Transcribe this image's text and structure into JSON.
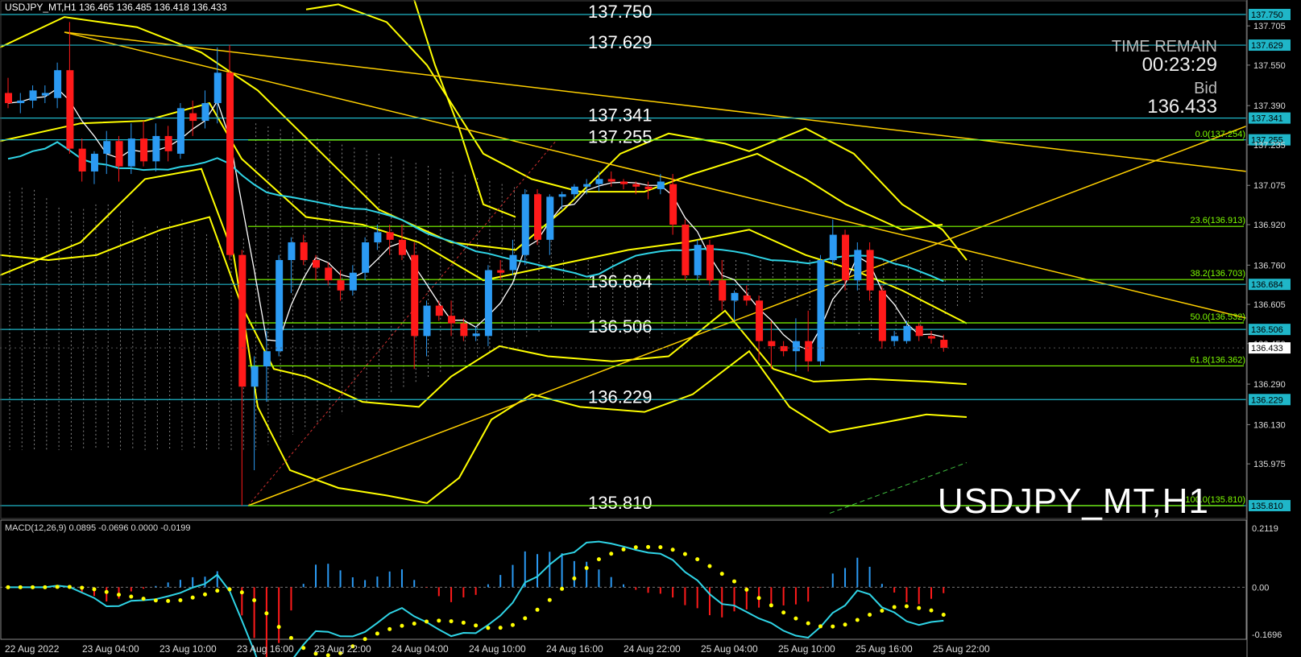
{
  "header": {
    "symbol_line": "USDJPY_MT,H1  136.465 136.485 136.418 136.433"
  },
  "info": {
    "time_remain_label": "TIME REMAIN",
    "time_remain_value": "00:23:29",
    "bid_label": "Bid",
    "bid_value": "136.433"
  },
  "watermark": "USDJPY_MT,H1",
  "macd_label": "MACD(12,26,9) 0.0895 -0.0696 0.0000 -0.0199",
  "colors": {
    "background": "#000000",
    "up_candle": "#2b9af3",
    "down_candle": "#ff1a1a",
    "bollinger": "#ffff00",
    "trendline": "#ffd000",
    "ma_cyan": "#2fd4e6",
    "ma_white": "#ffffff",
    "hline_cyan": "#1fb6c8",
    "fib_green": "#7fff00",
    "macd_line": "#2fd4e6",
    "macd_signal": "#ffff00"
  },
  "price_axis": {
    "ticks": [
      "137.705",
      "137.550",
      "137.390",
      "137.235",
      "137.075",
      "136.920",
      "136.760",
      "136.605",
      "136.450",
      "136.290",
      "136.130",
      "135.975"
    ],
    "ticks_values": [
      137.705,
      137.55,
      137.39,
      137.235,
      137.075,
      136.92,
      136.76,
      136.605,
      136.45,
      136.29,
      136.13,
      135.975
    ],
    "current_price": "136.433",
    "range": [
      135.79,
      137.77
    ]
  },
  "level_lines": [
    {
      "label": "137.750",
      "value": 137.75
    },
    {
      "label": "137.629",
      "value": 137.629
    },
    {
      "label": "137.341",
      "value": 137.341
    },
    {
      "label": "137.255",
      "value": 137.255
    },
    {
      "label": "136.684",
      "value": 136.684
    },
    {
      "label": "136.506",
      "value": 136.506
    },
    {
      "label": "136.229",
      "value": 136.229
    },
    {
      "label": "135.810",
      "value": 135.81
    }
  ],
  "fib_levels": [
    {
      "label": "0.0(137.254)",
      "value": 137.254
    },
    {
      "label": "23.6(136.913)",
      "value": 136.913
    },
    {
      "label": "38.2(136.703)",
      "value": 136.703
    },
    {
      "label": "50.0(136.532)",
      "value": 136.532
    },
    {
      "label": "61.8(136.362)",
      "value": 136.362
    },
    {
      "label": "100.0(135.810)",
      "value": 135.81
    }
  ],
  "time_axis": [
    "22 Aug 2022",
    "23 Aug 04:00",
    "23 Aug 10:00",
    "23 Aug 16:00",
    "23 Aug 22:00",
    "24 Aug 04:00",
    "24 Aug 10:00",
    "24 Aug 16:00",
    "24 Aug 22:00",
    "25 Aug 04:00",
    "25 Aug 10:00",
    "25 Aug 16:00",
    "25 Aug 22:00"
  ],
  "macd_axis": [
    "0.2119",
    "0.00",
    "-0.1696"
  ],
  "macd_axis_values": [
    0.2119,
    0.0,
    -0.1696
  ],
  "chart_data": {
    "type": "candlestick",
    "candles": [
      {
        "o": 137.44,
        "h": 137.5,
        "l": 137.38,
        "c": 137.4
      },
      {
        "o": 137.4,
        "h": 137.44,
        "l": 137.36,
        "c": 137.41
      },
      {
        "o": 137.41,
        "h": 137.47,
        "l": 137.38,
        "c": 137.45
      },
      {
        "o": 137.43,
        "h": 137.47,
        "l": 137.4,
        "c": 137.44
      },
      {
        "o": 137.42,
        "h": 137.56,
        "l": 137.38,
        "c": 137.53
      },
      {
        "o": 137.53,
        "h": 137.72,
        "l": 137.2,
        "c": 137.22
      },
      {
        "o": 137.22,
        "h": 137.26,
        "l": 137.09,
        "c": 137.13
      },
      {
        "o": 137.13,
        "h": 137.21,
        "l": 137.08,
        "c": 137.2
      },
      {
        "o": 137.2,
        "h": 137.29,
        "l": 137.12,
        "c": 137.25
      },
      {
        "o": 137.25,
        "h": 137.27,
        "l": 137.09,
        "c": 137.15
      },
      {
        "o": 137.15,
        "h": 137.32,
        "l": 137.12,
        "c": 137.26
      },
      {
        "o": 137.26,
        "h": 137.33,
        "l": 137.15,
        "c": 137.17
      },
      {
        "o": 137.17,
        "h": 137.32,
        "l": 137.13,
        "c": 137.27
      },
      {
        "o": 137.27,
        "h": 137.31,
        "l": 137.17,
        "c": 137.21
      },
      {
        "o": 137.2,
        "h": 137.4,
        "l": 137.18,
        "c": 137.38
      },
      {
        "o": 137.36,
        "h": 137.41,
        "l": 137.27,
        "c": 137.33
      },
      {
        "o": 137.33,
        "h": 137.45,
        "l": 137.3,
        "c": 137.4
      },
      {
        "o": 137.4,
        "h": 137.62,
        "l": 137.32,
        "c": 137.52
      },
      {
        "o": 137.52,
        "h": 137.63,
        "l": 136.78,
        "c": 136.8
      },
      {
        "o": 136.8,
        "h": 136.82,
        "l": 135.81,
        "c": 136.28
      },
      {
        "o": 136.28,
        "h": 136.4,
        "l": 135.95,
        "c": 136.36
      },
      {
        "o": 136.36,
        "h": 136.5,
        "l": 136.22,
        "c": 136.42
      },
      {
        "o": 136.42,
        "h": 136.8,
        "l": 136.4,
        "c": 136.78
      },
      {
        "o": 136.78,
        "h": 136.87,
        "l": 136.65,
        "c": 136.85
      },
      {
        "o": 136.85,
        "h": 136.88,
        "l": 136.76,
        "c": 136.78
      },
      {
        "o": 136.78,
        "h": 136.8,
        "l": 136.7,
        "c": 136.75
      },
      {
        "o": 136.75,
        "h": 136.77,
        "l": 136.68,
        "c": 136.7
      },
      {
        "o": 136.7,
        "h": 136.74,
        "l": 136.62,
        "c": 136.66
      },
      {
        "o": 136.66,
        "h": 136.76,
        "l": 136.64,
        "c": 136.73
      },
      {
        "o": 136.73,
        "h": 136.87,
        "l": 136.7,
        "c": 136.85
      },
      {
        "o": 136.85,
        "h": 136.92,
        "l": 136.82,
        "c": 136.89
      },
      {
        "o": 136.89,
        "h": 136.92,
        "l": 136.8,
        "c": 136.86
      },
      {
        "o": 136.86,
        "h": 136.92,
        "l": 136.78,
        "c": 136.8
      },
      {
        "o": 136.8,
        "h": 136.85,
        "l": 136.35,
        "c": 136.48
      },
      {
        "o": 136.48,
        "h": 136.62,
        "l": 136.4,
        "c": 136.6
      },
      {
        "o": 136.6,
        "h": 136.62,
        "l": 136.54,
        "c": 136.56
      },
      {
        "o": 136.56,
        "h": 136.62,
        "l": 136.48,
        "c": 136.53
      },
      {
        "o": 136.53,
        "h": 136.55,
        "l": 136.46,
        "c": 136.48
      },
      {
        "o": 136.48,
        "h": 136.52,
        "l": 136.46,
        "c": 136.49
      },
      {
        "o": 136.48,
        "h": 136.76,
        "l": 136.44,
        "c": 136.74
      },
      {
        "o": 136.74,
        "h": 136.78,
        "l": 136.7,
        "c": 136.73
      },
      {
        "o": 136.74,
        "h": 136.86,
        "l": 136.72,
        "c": 136.8
      },
      {
        "o": 136.8,
        "h": 137.06,
        "l": 136.76,
        "c": 137.04
      },
      {
        "o": 137.04,
        "h": 137.06,
        "l": 136.84,
        "c": 136.86
      },
      {
        "o": 136.86,
        "h": 137.04,
        "l": 136.8,
        "c": 137.03
      },
      {
        "o": 137.03,
        "h": 137.05,
        "l": 136.98,
        "c": 137.04
      },
      {
        "o": 137.04,
        "h": 137.08,
        "l": 137.02,
        "c": 137.07
      },
      {
        "o": 137.07,
        "h": 137.1,
        "l": 137.04,
        "c": 137.08
      },
      {
        "o": 137.08,
        "h": 137.13,
        "l": 137.05,
        "c": 137.1
      },
      {
        "o": 137.1,
        "h": 137.13,
        "l": 137.07,
        "c": 137.09
      },
      {
        "o": 137.09,
        "h": 137.1,
        "l": 137.06,
        "c": 137.08
      },
      {
        "o": 137.08,
        "h": 137.09,
        "l": 137.04,
        "c": 137.07
      },
      {
        "o": 137.07,
        "h": 137.09,
        "l": 137.02,
        "c": 137.06
      },
      {
        "o": 137.06,
        "h": 137.12,
        "l": 137.04,
        "c": 137.09
      },
      {
        "o": 137.08,
        "h": 137.12,
        "l": 136.88,
        "c": 136.92
      },
      {
        "o": 136.92,
        "h": 136.94,
        "l": 136.7,
        "c": 136.72
      },
      {
        "o": 136.72,
        "h": 136.86,
        "l": 136.7,
        "c": 136.84
      },
      {
        "o": 136.84,
        "h": 136.86,
        "l": 136.68,
        "c": 136.7
      },
      {
        "o": 136.7,
        "h": 136.78,
        "l": 136.58,
        "c": 136.62
      },
      {
        "o": 136.62,
        "h": 136.66,
        "l": 136.54,
        "c": 136.65
      },
      {
        "o": 136.64,
        "h": 136.68,
        "l": 136.6,
        "c": 136.62
      },
      {
        "o": 136.62,
        "h": 136.64,
        "l": 136.38,
        "c": 136.46
      },
      {
        "o": 136.46,
        "h": 136.54,
        "l": 136.35,
        "c": 136.44
      },
      {
        "o": 136.44,
        "h": 136.46,
        "l": 136.4,
        "c": 136.42
      },
      {
        "o": 136.42,
        "h": 136.55,
        "l": 136.34,
        "c": 136.46
      },
      {
        "o": 136.46,
        "h": 136.58,
        "l": 136.34,
        "c": 136.38
      },
      {
        "o": 136.38,
        "h": 136.8,
        "l": 136.36,
        "c": 136.78
      },
      {
        "o": 136.78,
        "h": 136.94,
        "l": 136.76,
        "c": 136.88
      },
      {
        "o": 136.88,
        "h": 136.9,
        "l": 136.66,
        "c": 136.7
      },
      {
        "o": 136.7,
        "h": 136.85,
        "l": 136.66,
        "c": 136.82
      },
      {
        "o": 136.82,
        "h": 136.85,
        "l": 136.62,
        "c": 136.66
      },
      {
        "o": 136.66,
        "h": 136.68,
        "l": 136.43,
        "c": 136.46
      },
      {
        "o": 136.46,
        "h": 136.5,
        "l": 136.44,
        "c": 136.48
      },
      {
        "o": 136.46,
        "h": 136.54,
        "l": 136.45,
        "c": 136.52
      },
      {
        "o": 136.52,
        "h": 136.53,
        "l": 136.46,
        "c": 136.48
      },
      {
        "o": 136.48,
        "h": 136.5,
        "l": 136.45,
        "c": 136.47
      },
      {
        "o": 136.465,
        "h": 136.485,
        "l": 136.418,
        "c": 136.433
      }
    ]
  }
}
